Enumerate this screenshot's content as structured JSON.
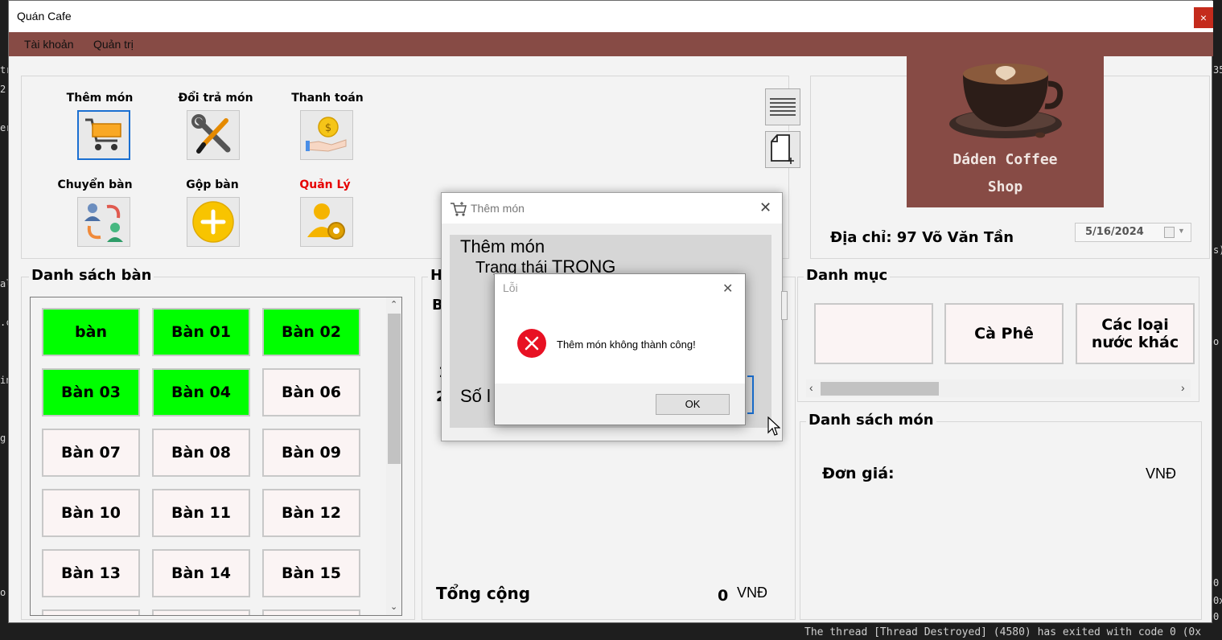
{
  "window": {
    "title": "Quán Cafe",
    "close_glyph": "×"
  },
  "menu": [
    "Tài khoản",
    "Quản trị"
  ],
  "toolbar": [
    {
      "label": "Thêm món",
      "icon": "cart-icon"
    },
    {
      "label": "Đổi trả món",
      "icon": "tools-icon"
    },
    {
      "label": "Thanh toán",
      "icon": "coin-hand-icon"
    },
    {
      "label": "Chuyển bàn",
      "icon": "transfer-users-icon"
    },
    {
      "label": "Gộp bàn",
      "icon": "plus-circle-icon"
    },
    {
      "label": "Quản Lý",
      "icon": "user-gear-icon"
    }
  ],
  "shop": {
    "name": "Dáden Coffee",
    "subtitle": "Shop",
    "address": "Địa chỉ: 97 Võ Văn Tần",
    "date": "5/16/2024"
  },
  "tables_title": "Danh sách bàn",
  "tables": [
    {
      "label": "bàn",
      "status": "busy"
    },
    {
      "label": "Bàn 01",
      "status": "busy"
    },
    {
      "label": "Bàn 02",
      "status": "busy"
    },
    {
      "label": "Bàn 03",
      "status": "busy"
    },
    {
      "label": "Bàn 04",
      "status": "busy"
    },
    {
      "label": "Bàn 06",
      "status": "free"
    },
    {
      "label": "Bàn 07",
      "status": "free"
    },
    {
      "label": "Bàn 08",
      "status": "free"
    },
    {
      "label": "Bàn 09",
      "status": "free"
    },
    {
      "label": "Bàn 10",
      "status": "free"
    },
    {
      "label": "Bàn 11",
      "status": "free"
    },
    {
      "label": "Bàn 12",
      "status": "free"
    },
    {
      "label": "Bàn 13",
      "status": "free"
    },
    {
      "label": "Bàn 14",
      "status": "free"
    },
    {
      "label": "Bàn 15",
      "status": "free"
    }
  ],
  "order": {
    "title_fragment": "H",
    "row_fragment": "Bà",
    "num_fragment_1": "1",
    "num_fragment_2": "2",
    "total_label": "Tổng cộng",
    "total_value": "0",
    "currency": "VNĐ"
  },
  "categories_title": "Danh mục",
  "categories": [
    "",
    "Cà Phê",
    "Các loại\nnước khác"
  ],
  "dishes": {
    "title": "Danh sách món",
    "price_label": "Đơn giá:",
    "currency": "VNĐ"
  },
  "add_dialog": {
    "title": "Thêm món",
    "heading": "Thêm món",
    "status_label": "Trạng thái",
    "status_value": "TRONG",
    "qty_fragment": "Số l"
  },
  "error_dialog": {
    "title": "Lỗi",
    "message": "Thêm món không thành công!",
    "ok_label": "OK",
    "close_glyph": "✕"
  },
  "colors": {
    "menubar": "#874b45",
    "busy_table": "#00ff00",
    "free_table": "#fbf4f4",
    "error_red": "#e81123",
    "accent_blue": "#1a6fd1"
  }
}
